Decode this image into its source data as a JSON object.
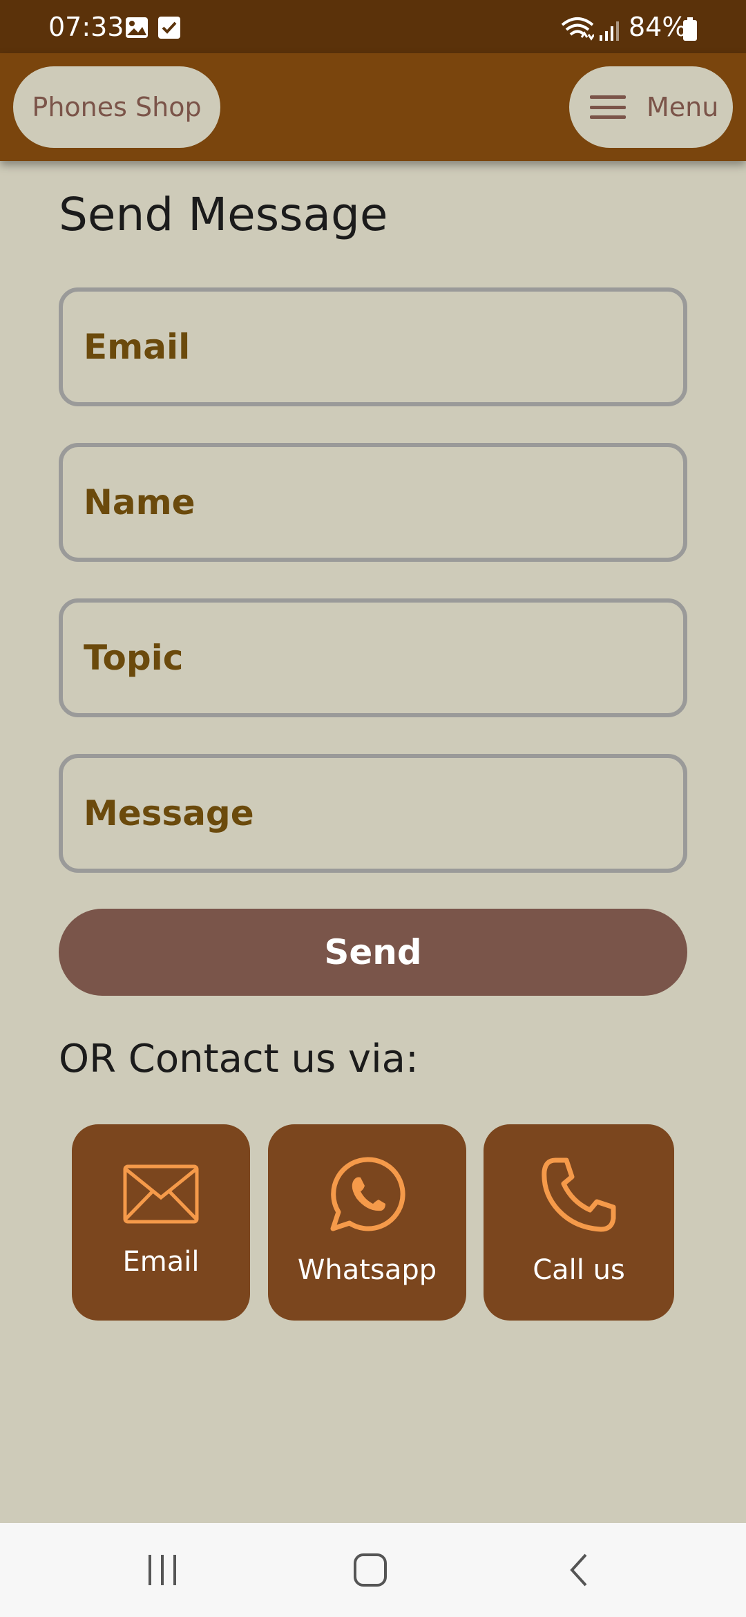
{
  "status_bar": {
    "time": "07:33",
    "battery": "84%"
  },
  "app_bar": {
    "brand": "Phones Shop",
    "menu_label": "Menu"
  },
  "page": {
    "title": "Send Message"
  },
  "form": {
    "email_placeholder": "Email",
    "name_placeholder": "Name",
    "topic_placeholder": "Topic",
    "message_placeholder": "Message",
    "send_label": "Send"
  },
  "contact": {
    "heading": "OR Contact us via:",
    "options": [
      {
        "label": "Email",
        "icon": "envelope-icon"
      },
      {
        "label": "Whatsapp",
        "icon": "whatsapp-icon"
      },
      {
        "label": "Call us",
        "icon": "phone-icon"
      }
    ]
  },
  "colors": {
    "status_bar": "#5b320a",
    "app_bar": "#7a450d",
    "background": "#cecbb9",
    "pill_text": "#7b5449",
    "placeholder": "#6b4a0c",
    "send_button": "#7a554a",
    "contact_card": "#7b461e",
    "contact_icon": "#f59a4a"
  }
}
